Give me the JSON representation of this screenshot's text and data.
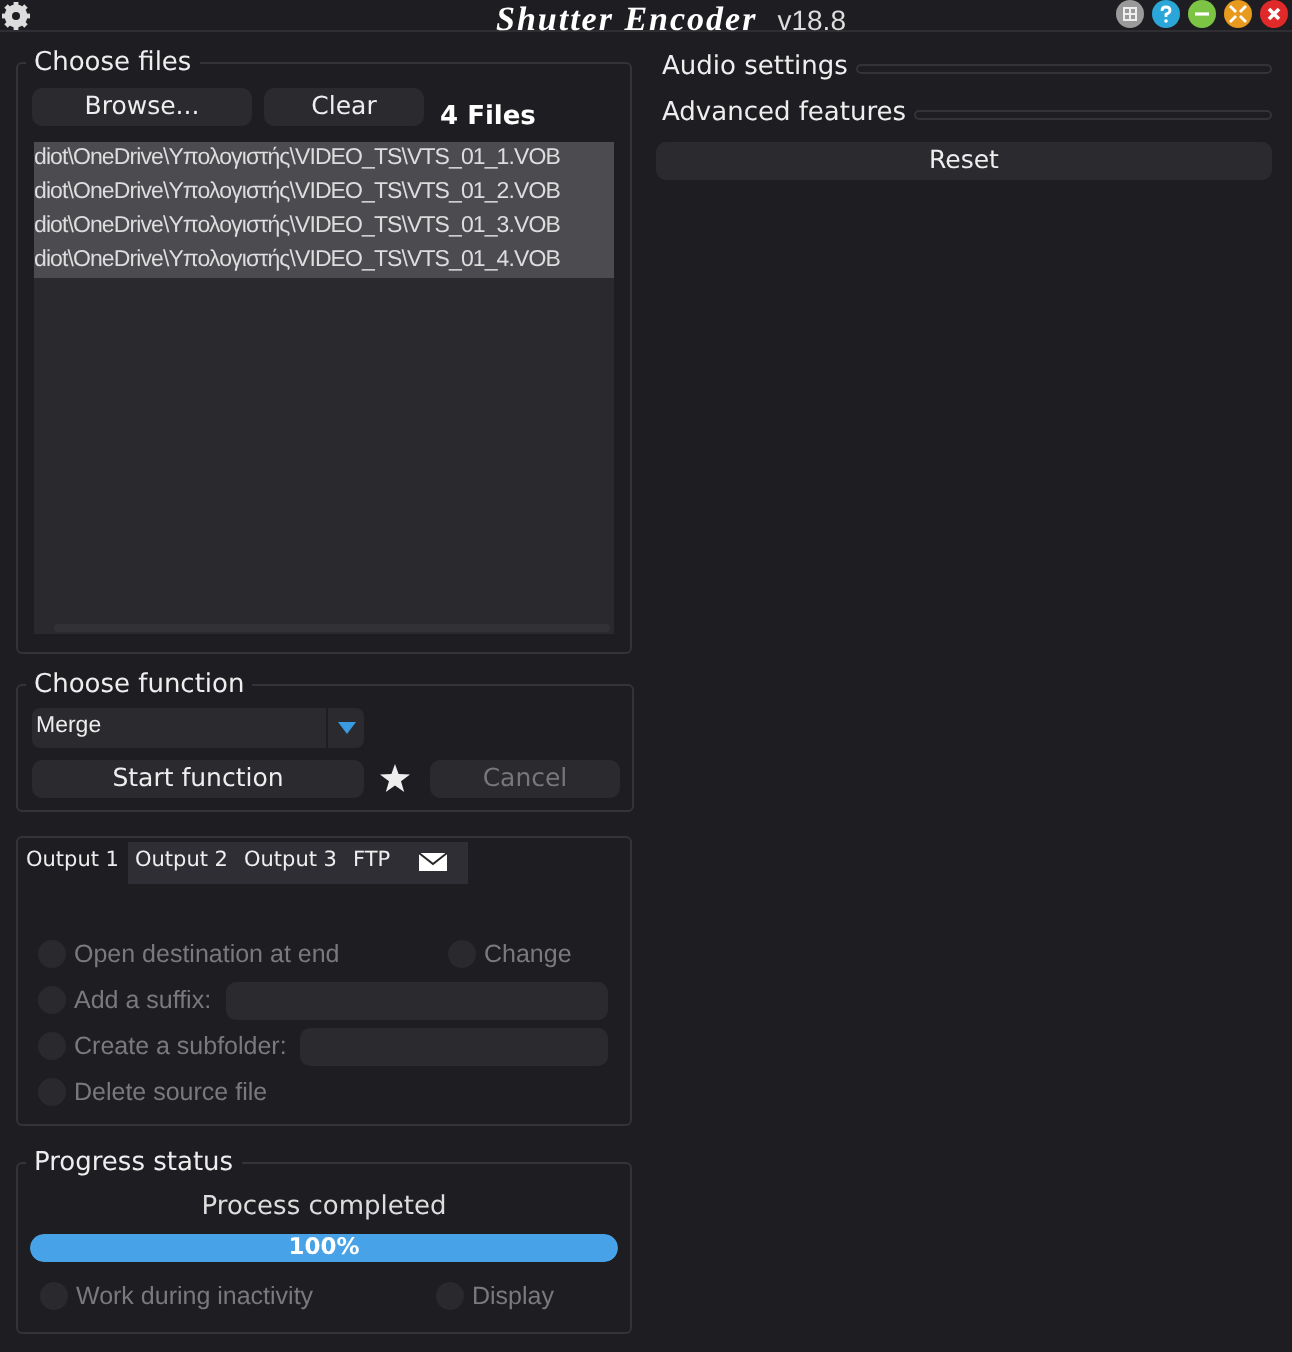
{
  "window": {
    "title": "Shutter Encoder",
    "version": "v18.8"
  },
  "choose_files": {
    "title": "Choose files",
    "browse_button": "Browse...",
    "clear_button": "Clear",
    "file_count": "4 Files",
    "files": [
      {
        "path": "diot\\OneDrive\\Υπολογιστής\\VIDEO_TS\\VTS_01_1.VOB",
        "selected": true
      },
      {
        "path": "diot\\OneDrive\\Υπολογιστής\\VIDEO_TS\\VTS_01_2.VOB",
        "selected": true
      },
      {
        "path": "diot\\OneDrive\\Υπολογιστής\\VIDEO_TS\\VTS_01_3.VOB",
        "selected": true
      },
      {
        "path": "diot\\OneDrive\\Υπολογιστής\\VIDEO_TS\\VTS_01_4.VOB",
        "selected": true
      }
    ]
  },
  "choose_function": {
    "title": "Choose function",
    "value": "Merge",
    "start_button": "Start function",
    "cancel_button": {
      "label": "Cancel",
      "disabled": true
    }
  },
  "output_tabs": [
    {
      "kind": "text",
      "label": "Output 1",
      "selected": true
    },
    {
      "kind": "text",
      "label": "Output 2",
      "selected": false
    },
    {
      "kind": "text",
      "label": "Output 3",
      "selected": false
    },
    {
      "kind": "text",
      "label": "FTP",
      "selected": false
    },
    {
      "kind": "mail",
      "selected": false
    }
  ],
  "output_options": [
    [
      {
        "kind": "checkbox",
        "label": "Open destination at end",
        "checked": false,
        "disabled": true
      },
      {
        "kind": "checkbox",
        "label": "Change",
        "checked": false,
        "disabled": true
      }
    ],
    [
      {
        "kind": "field",
        "label": "Add a suffix:",
        "checked": false,
        "disabled": true
      }
    ],
    [
      {
        "kind": "field",
        "label": "Create a subfolder:",
        "checked": false,
        "disabled": true
      }
    ],
    [
      {
        "kind": "checkbox",
        "label": "Delete source file",
        "checked": false,
        "disabled": true
      }
    ]
  ],
  "progress": {
    "title": "Progress status",
    "message": "Process completed",
    "level": 1,
    "reading": "100%",
    "options": [
      {
        "label": "Work during inactivity",
        "checked": false,
        "disabled": true
      },
      {
        "label": "Display",
        "checked": false,
        "disabled": true
      }
    ]
  },
  "right_sections": [
    {
      "title": "Audio settings",
      "expanded": false
    },
    {
      "title": "Advanced features",
      "expanded": false
    }
  ],
  "reset_button": "Reset"
}
